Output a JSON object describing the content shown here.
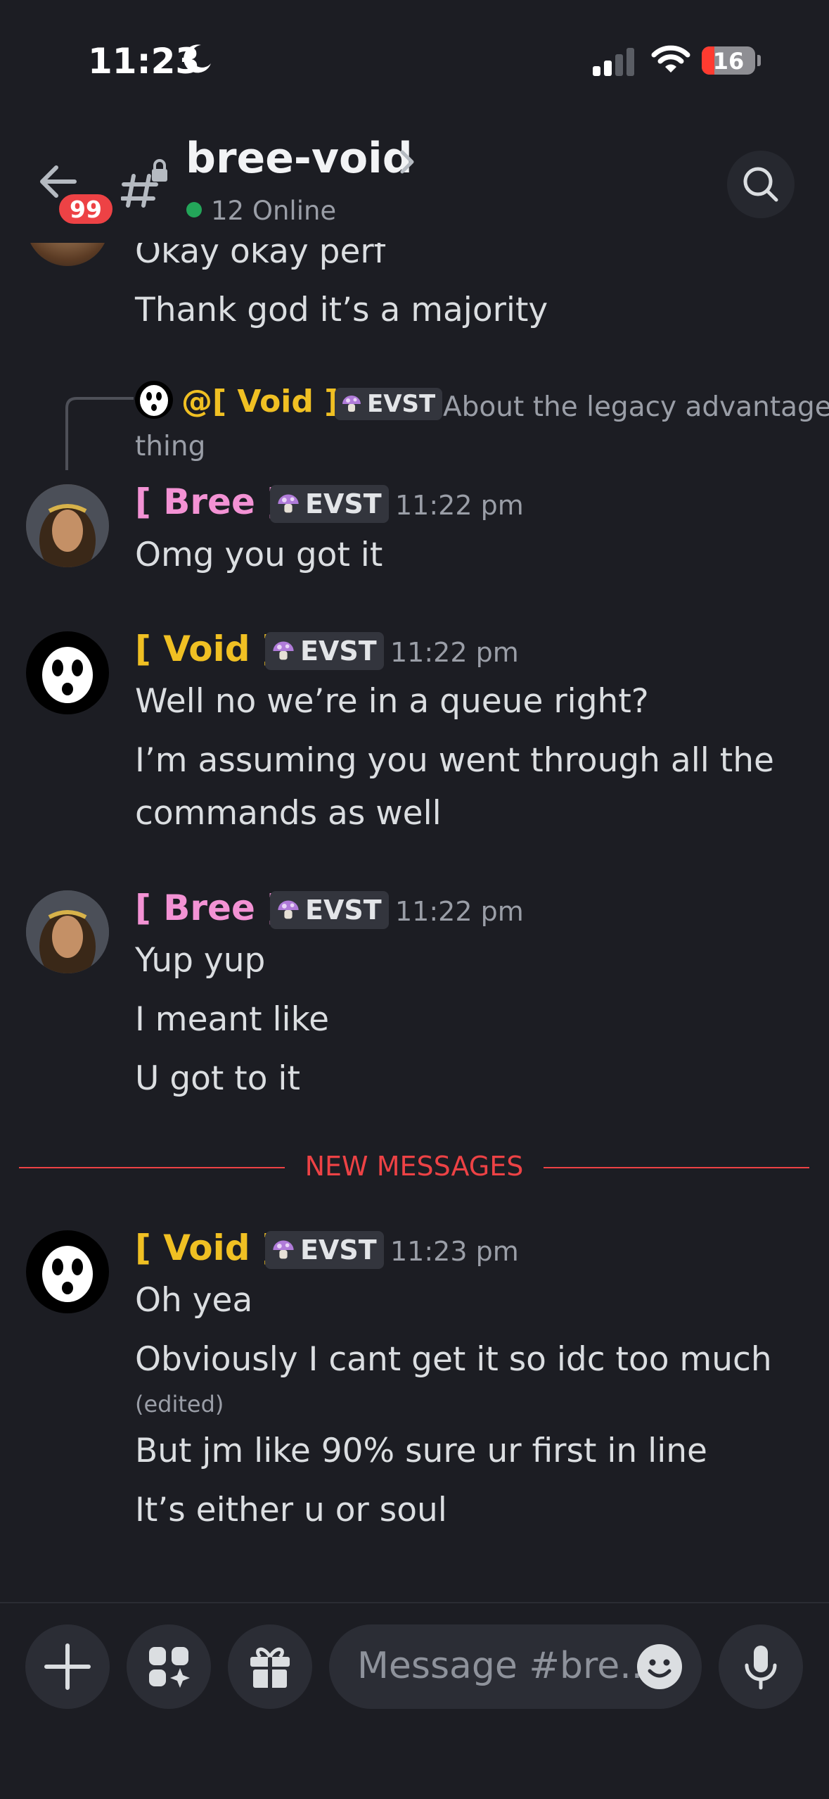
{
  "status_bar": {
    "time": "11:23",
    "battery": "16"
  },
  "header": {
    "badge": "99",
    "channel": "bree-void",
    "online": "12 Online"
  },
  "reply": {
    "mention": "@[ Void ]",
    "tag": "EVST",
    "preview_line1": "About the legacy advantage",
    "preview_line2": "thing"
  },
  "messages": {
    "top_lines": [
      "Okay okay perf",
      "Thank god it’s a majority"
    ],
    "m1": {
      "author": "[ Bree ]",
      "tag": "EVST",
      "time": "11:22 pm",
      "lines": [
        "Omg you got it"
      ]
    },
    "m2": {
      "author": "[ Void ]",
      "tag": "EVST",
      "time": "11:22 pm",
      "lines": [
        "Well no we’re in a queue right?",
        "I’m assuming you went through all the",
        "commands as well"
      ]
    },
    "m3": {
      "author": "[ Bree ]",
      "tag": "EVST",
      "time": "11:22 pm",
      "lines": [
        "Yup yup",
        "I meant like",
        "U got to it"
      ]
    },
    "divider": "NEW MESSAGES",
    "m4": {
      "author": "[ Void ]",
      "tag": "EVST",
      "time": "11:23 pm",
      "lines": [
        "Oh yea",
        "Obviously I cant get it so idc too much",
        "(edited)",
        "But jm like 90% sure ur first in line",
        "It’s either u or soul"
      ]
    }
  },
  "composer": {
    "placeholder": "Message #bre..."
  },
  "colors": {
    "background": "#1c1d23",
    "bree": "#f392d4",
    "void": "#f0c023",
    "new_messages": "#ed4245",
    "online": "#23a559"
  },
  "icons": [
    "moon-icon",
    "signal-icon",
    "wifi-icon",
    "battery-icon",
    "back-arrow-icon",
    "locked-channel-icon",
    "chevron-right-icon",
    "search-icon",
    "plus-icon",
    "apps-icon",
    "gift-icon",
    "emoji-icon",
    "microphone-icon",
    "evst-mushroom-icon"
  ]
}
